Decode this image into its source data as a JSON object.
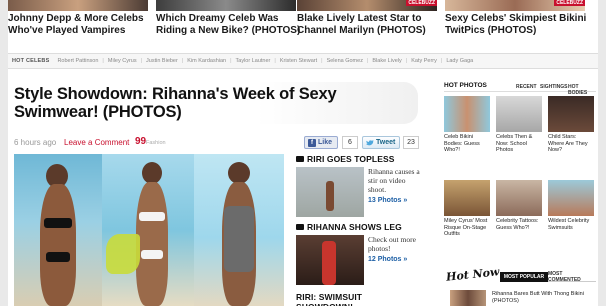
{
  "top_stories": [
    {
      "title": "Johnny Depp & More Celebs Who've Played Vampires",
      "badge": ""
    },
    {
      "title": "Which Dreamy Celeb Was Riding a New Bike? (PHOTOS)",
      "badge": ""
    },
    {
      "title": "Blake Lively Latest Star to Channel Marilyn (PHOTOS)",
      "badge": "CELEBUZZ"
    },
    {
      "title": "Sexy Celebs' Skimpiest Bikini TwitPics (PHOTOS)",
      "badge": "CELEBUZZ"
    }
  ],
  "hot_celebs": {
    "label": "HOT CELEBS",
    "names": [
      "Robert Pattinson",
      "Miley Cyrus",
      "Justin Bieber",
      "Kim Kardashian",
      "Taylor Lautner",
      "Kristen Stewart",
      "Selena Gomez",
      "Blake Lively",
      "Katy Perry",
      "Lady Gaga"
    ]
  },
  "article": {
    "title": "Style Showdown: Rihanna's Week of Sexy Swimwear! (PHOTOS)",
    "time": "6 hours ago",
    "comment_label": "Leave a Comment",
    "quote_mark": "99",
    "category": "Fashion",
    "like_label": "Like",
    "like_count": "6",
    "tweet_label": "Tweet",
    "tweet_count": "23"
  },
  "side_stories": [
    {
      "heading": "RIRI GOES TOPLESS",
      "text": "Rihanna causes a stir on video shoot.",
      "link": "13 Photos »"
    },
    {
      "heading": "RIHANNA SHOWS LEG",
      "text": "Check out more photos!",
      "link": "12 Photos »"
    },
    {
      "heading": "RIRI: SWIMSUIT SHOWDOWN!",
      "text": "",
      "link": ""
    }
  ],
  "hot_photos": {
    "title": "HOT PHOTOS",
    "tabs": [
      "RECENT",
      "SIGHTINGS",
      "HOT BODIES"
    ],
    "items": [
      {
        "caption": "Celeb Bikini Bodies: Guess Who?!"
      },
      {
        "caption": "Celebs Then & Now: School Photos"
      },
      {
        "caption": "Child Stars: Where Are They Now?"
      },
      {
        "caption": "Miley Cyrus' Most Risque On-Stage Outfits"
      },
      {
        "caption": "Celebrity Tattoos: Guess Who?!"
      },
      {
        "caption": "Wildest Celebrity Swimsuits"
      }
    ]
  },
  "hot_now": {
    "logo": "Hot Now",
    "tabs": [
      "MOST POPULAR",
      "MOST COMMENTED"
    ],
    "item": "Rihanna Bares Butt With Thong Bikini (PHOTOS)"
  },
  "colors": {
    "accent": "#c8102e",
    "link": "#1d5fa5",
    "facebook": "#3b5998",
    "twitter": "#186487"
  }
}
